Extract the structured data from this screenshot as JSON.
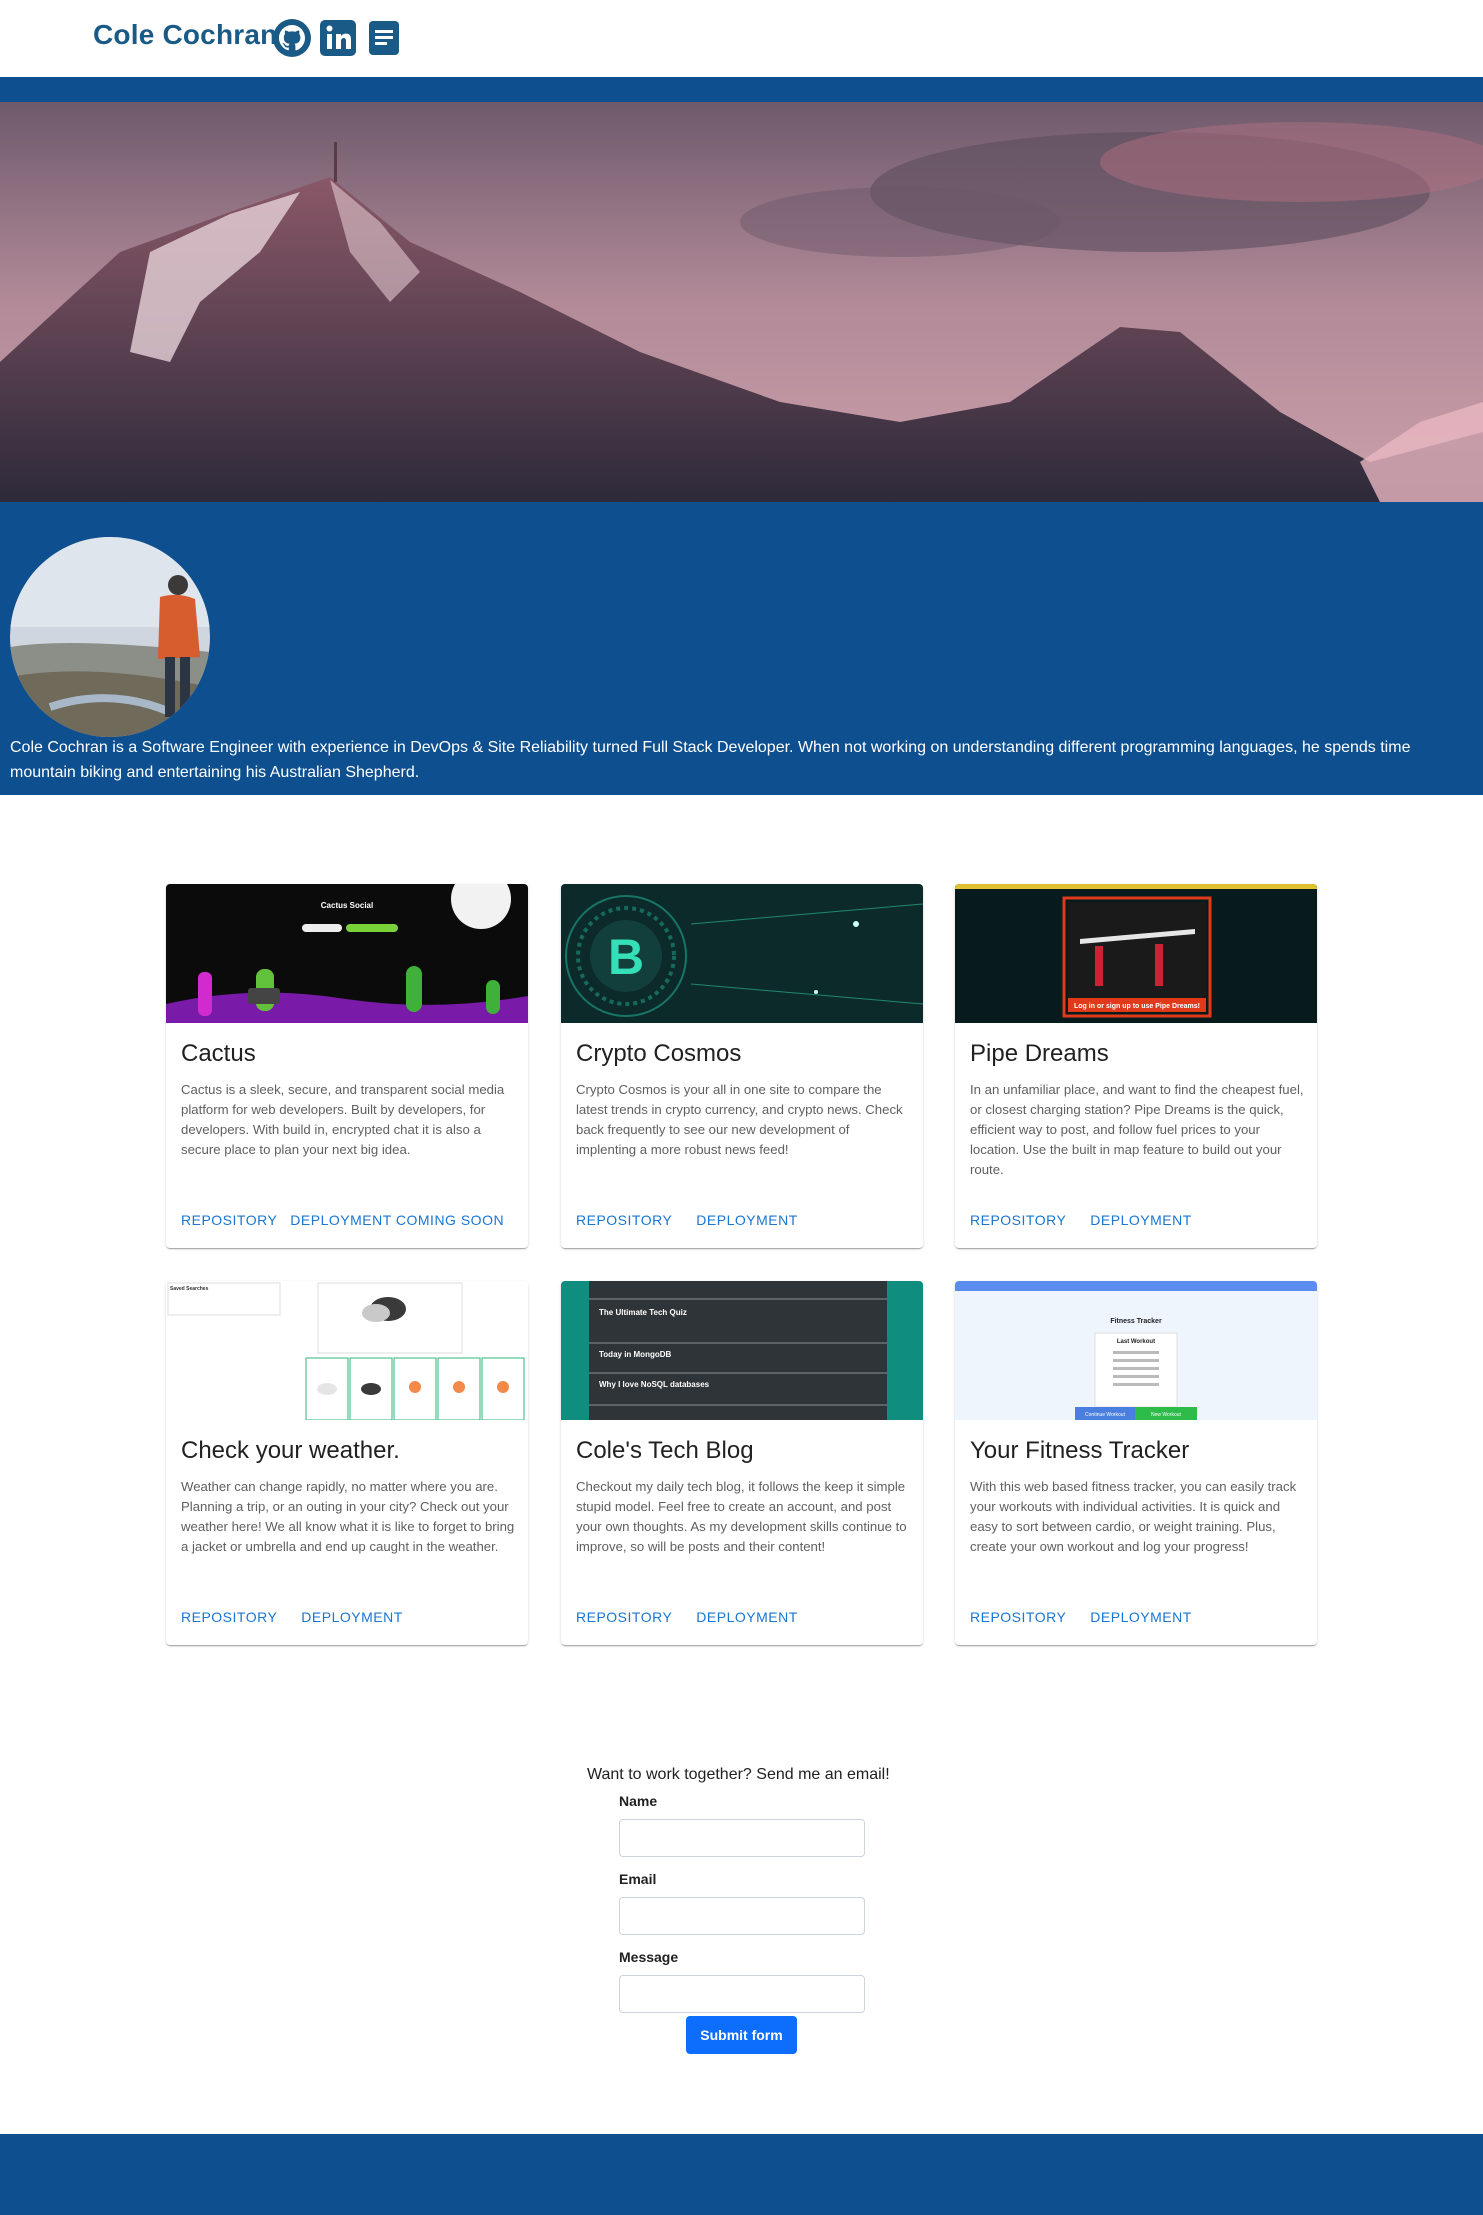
{
  "header": {
    "brand": "Cole Cochran",
    "icons": [
      "github-icon",
      "linkedin-icon",
      "resume-document-icon"
    ]
  },
  "hero": {
    "bio": "Cole Cochran is a Software Engineer with experience in DevOps & Site Reliability turned Full Stack Developer. When not working on understanding different programming languages, he spends time mountain biking and entertaining his Australian Shepherd."
  },
  "projects": [
    {
      "title": "Cactus",
      "description": "Cactus is a sleek, secure, and transparent social media platform for web developers. Built by developers, for developers. With build in, encrypted chat it is also a secure place to plan your next big idea.",
      "repo_label": "Repository",
      "deploy_label": "Deployment Coming Soon",
      "thumb_text": "Cactus Social"
    },
    {
      "title": "Crypto Cosmos",
      "description": "Crypto Cosmos is your all in one site to compare the latest trends in crypto currency, and crypto news. Check back frequently to see our new development of implenting a more robust news feed!",
      "repo_label": "Repository",
      "deploy_label": "Deployment"
    },
    {
      "title": "Pipe Dreams",
      "description": "In an unfamiliar place, and want to find the cheapest fuel, or closest charging station? Pipe Dreams is the quick, efficient way to post, and follow fuel prices to your location. Use the built in map feature to build out your route.",
      "repo_label": "Repository",
      "deploy_label": "Deployment",
      "thumb_text": "Log in or sign up to use Pipe Dreams!"
    },
    {
      "title": "Check your weather.",
      "description": "Weather can change rapidly, no matter where you are. Planning a trip, or an outing in your city? Check out your weather here! We all know what it is like to forget to bring a jacket or umbrella and end up caught in the weather.",
      "repo_label": "Repository",
      "deploy_label": "Deployment",
      "thumb_text": "Saved Searches"
    },
    {
      "title": "Cole's Tech Blog",
      "description": "Checkout my daily tech blog, it follows the keep it simple stupid model. Feel free to create an account, and post your own thoughts. As my development skills continue to improve, so will be posts and their content!",
      "repo_label": "Repository",
      "deploy_label": "Deployment",
      "thumb_lines": [
        "The Ultimate Tech Quiz",
        "Today in MongoDB",
        "Why I love NoSQL databases"
      ]
    },
    {
      "title": "Your Fitness Tracker",
      "description": "With this web based fitness tracker, you can easily track your workouts with individual activities. It is quick and easy to sort between cardio, or weight training. Plus, create your own workout and log your progress!",
      "repo_label": "Repository",
      "deploy_label": "Deployment",
      "thumb_text": "Fitness Tracker",
      "thumb_sub": "Last Workout",
      "thumb_buttons": [
        "Continue Workout",
        "New Workout"
      ]
    }
  ],
  "contact": {
    "lead": "Want to work together? Send me an email!",
    "name_label": "Name",
    "email_label": "Email",
    "message_label": "Message",
    "submit_label": "Submit form"
  },
  "colors": {
    "brand_blue": "#0d4f8f",
    "link_blue": "#1976d2",
    "button_blue": "#0d6efd"
  }
}
